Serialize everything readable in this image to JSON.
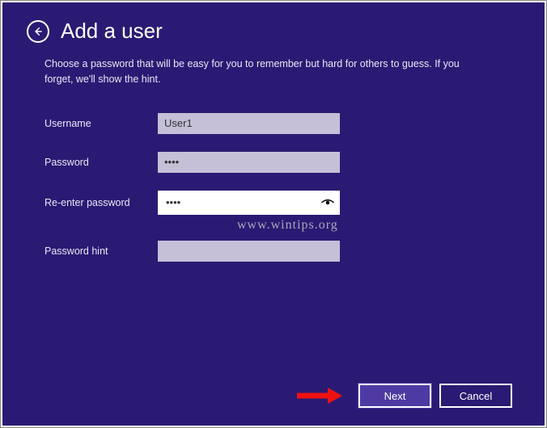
{
  "title": "Add a user",
  "subtitle": "Choose a password that will be easy for you to remember but hard for others to guess. If you forget, we'll show the hint.",
  "fields": {
    "username": {
      "label": "Username",
      "value": "User1"
    },
    "password": {
      "label": "Password",
      "value": "••••"
    },
    "reenter": {
      "label": "Re-enter password",
      "value": "••••"
    },
    "hint": {
      "label": "Password hint",
      "value": ""
    }
  },
  "buttons": {
    "next": "Next",
    "cancel": "Cancel"
  },
  "watermark": "www.wintips.org"
}
